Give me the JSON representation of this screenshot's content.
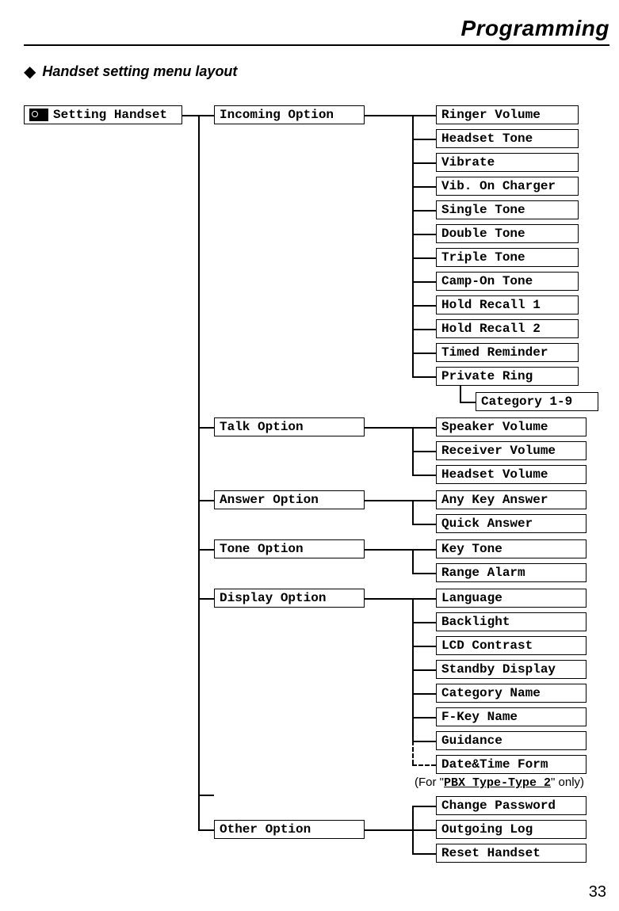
{
  "header": {
    "chapter_title": "Programming",
    "section_title": "Handset setting menu layout"
  },
  "root": {
    "label": "Setting Handset"
  },
  "groups": {
    "incoming": {
      "label": "Incoming Option",
      "items": [
        "Ringer Volume",
        "Headset Tone",
        "Vibrate",
        "Vib. On Charger",
        "Single Tone",
        "Double Tone",
        "Triple Tone",
        "Camp-On Tone",
        "Hold Recall 1",
        "Hold Recall 2",
        "Timed Reminder",
        "Private Ring"
      ],
      "sub": "Category 1-9"
    },
    "talk": {
      "label": "Talk Option",
      "items": [
        "Speaker Volume",
        "Receiver Volume",
        "Headset Volume"
      ]
    },
    "answer": {
      "label": "Answer Option",
      "items": [
        "Any Key Answer",
        "Quick Answer"
      ]
    },
    "tone": {
      "label": "Tone Option",
      "items": [
        "Key Tone",
        "Range Alarm"
      ]
    },
    "display": {
      "label": "Display Option",
      "items": [
        "Language",
        "Backlight",
        "LCD Contrast",
        "Standby Display",
        "Category Name",
        "F-Key Name",
        "Guidance",
        "Date&Time Form"
      ]
    },
    "other": {
      "label": "Other Option",
      "items": [
        "Change Password",
        "Outgoing Log",
        "Reset Handset"
      ]
    }
  },
  "annotation": {
    "prefix": "(For \"",
    "bold": "PBX Type-Type 2",
    "suffix": "\" only)"
  },
  "page_number": "33"
}
